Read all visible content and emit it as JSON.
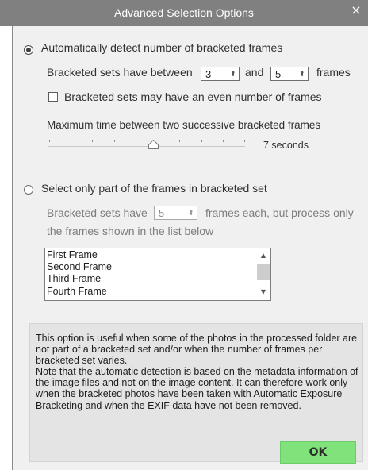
{
  "window": {
    "title": "Advanced Selection Options",
    "close_glyph": "×"
  },
  "auto_detect": {
    "label": "Automatically detect number of bracketed frames",
    "selected": true,
    "range_prefix": "Bracketed sets have between",
    "min_frames": "3",
    "and_text": "and",
    "max_frames": "5",
    "frames_text": "frames",
    "even_checkbox_label": "Bracketed sets may have an even number of frames",
    "even_checked": false,
    "max_time_label": "Maximum time between two successive bracketed frames",
    "max_time_value": "7 seconds",
    "slider_fraction": 0.5
  },
  "partial": {
    "label": "Select only part of the frames in bracketed set",
    "selected": false,
    "line1_prefix": "Bracketed sets have",
    "frames_each": "5",
    "line1_suffix": "frames each, but process only",
    "line2": "the frames shown in the list below",
    "list_items": [
      "First Frame",
      "Second Frame",
      "Third Frame",
      "Fourth Frame"
    ]
  },
  "info": {
    "paragraph1": "This option is useful when some of the photos in the processed folder are not part of a bracketed set and/or when the number of frames per bracketed set varies.",
    "paragraph2": "Note that the automatic detection is based on the metadata information of the image files and not on the image content.  It can therefore work only when the bracketed photos have been taken with Automatic Exposure Bracketing and when the EXIF data have not been removed."
  },
  "buttons": {
    "ok_label": "OK"
  },
  "icons": {
    "close": "close-icon",
    "spin": "spin-updown-icon",
    "scroll_up": "chevron-up-icon",
    "scroll_down": "chevron-down-icon",
    "slider_thumb": "slider-thumb-icon"
  },
  "colors": {
    "titlebar": "#808080",
    "dialog_bg": "#f0f0f0",
    "info_bg": "#e4e4e4",
    "ok_button": "#7fe27a"
  }
}
